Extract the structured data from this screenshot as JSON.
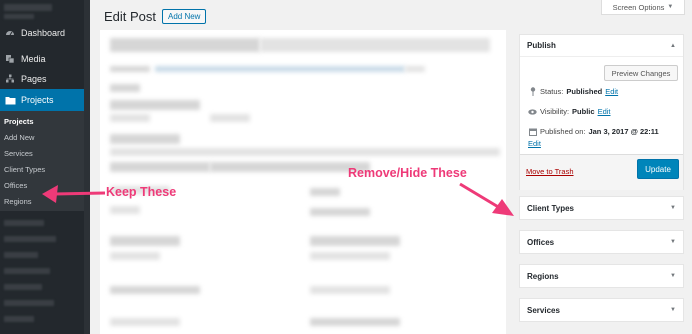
{
  "sidebar": {
    "menu": [
      {
        "label": "Dashboard",
        "icon": "dashboard-icon"
      },
      {
        "label": "Media",
        "icon": "media-icon"
      },
      {
        "label": "Pages",
        "icon": "pages-icon"
      },
      {
        "label": "Projects",
        "icon": "projects-icon",
        "active": true
      }
    ],
    "submenu": [
      {
        "label": "Projects",
        "current": true
      },
      {
        "label": "Add New"
      },
      {
        "label": "Services"
      },
      {
        "label": "Client Types"
      },
      {
        "label": "Offices"
      },
      {
        "label": "Regions"
      }
    ]
  },
  "header": {
    "title": "Edit Post",
    "add_new": "Add New",
    "screen_options": "Screen Options"
  },
  "publish": {
    "title": "Publish",
    "preview": "Preview Changes",
    "status_label": "Status:",
    "status_value": "Published",
    "visibility_label": "Visibility:",
    "visibility_value": "Public",
    "published_label": "Published on:",
    "published_value": "Jan 3, 2017 @ 22:11",
    "edit": "Edit",
    "trash": "Move to Trash",
    "update": "Update"
  },
  "taxonomies": [
    "Client Types",
    "Offices",
    "Regions",
    "Services"
  ],
  "annotations": {
    "keep": "Keep These",
    "remove": "Remove/Hide These",
    "color": "#ee3a78"
  },
  "colors": {
    "sidebar_bg": "#23282d",
    "accent": "#0073aa",
    "update_button": "#0085ba"
  }
}
